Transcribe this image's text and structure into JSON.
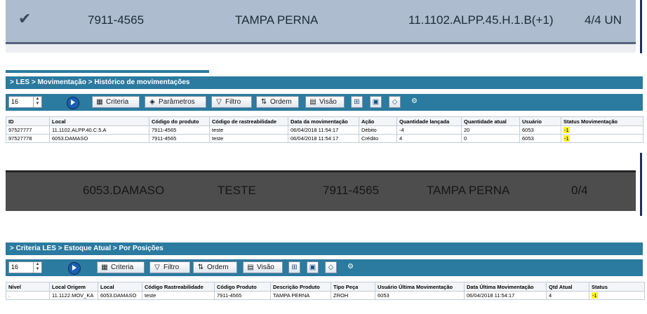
{
  "banner_top": {
    "check_icon": "✓",
    "product_code": "7911-4565",
    "description": "TAMPA PERNA",
    "location": "11.1102.ALPP.45.H.1.B(+1)",
    "quantity": "4/4 UN"
  },
  "window1": {
    "title": "> LES > Movimentação > Histórico de movimentações",
    "spinner_value": "16",
    "toolbar": {
      "criteria": "Criteria",
      "parametros": "Parâmetros",
      "filtro": "Filtro",
      "ordem": "Ordem",
      "visao": "Visão"
    },
    "columns": [
      "ID",
      "Local",
      "Código do produto",
      "Código de rastreabilidade",
      "Data da movimentação",
      "Ação",
      "Quantidade lançada",
      "Quantidade atual",
      "Usuário",
      "Status Movimentação"
    ],
    "rows": [
      [
        "97527777",
        "11.1102.ALPP.40.C.5.A",
        "7911-4565",
        "teste",
        "06/04/2018 11:54:17",
        "Débito",
        "-4",
        "20",
        "6053",
        "-1"
      ],
      [
        "97527778",
        "6053.DAMASO",
        "7911-4565",
        "teste",
        "06/04/2018 11:54:17",
        "Crédito",
        "4",
        "0",
        "6053",
        "-1"
      ]
    ]
  },
  "banner_dark": {
    "location": "6053.DAMASO",
    "tracking": "TESTE",
    "product_code": "7911-4565",
    "description": "TAMPA PERNA",
    "quantity": "0/4"
  },
  "window2": {
    "title": "> Criteria LES > Estoque Atual > Por Posições",
    "spinner_value": "16",
    "toolbar": {
      "criteria": "Criteria",
      "filtro": "Filtro",
      "ordem": "Ordem",
      "visao": "Visão"
    },
    "columns": [
      "Nível",
      "Local Origem",
      "Local",
      "Código Rastreabilidade",
      "Código Produto",
      "Descrição Produto",
      "Tipo Peça",
      "Usuário Última Movimentação",
      "Data Última Movimentação",
      "Qtd Atual",
      "Status"
    ],
    "rows": [
      [
        ".",
        "11.1122.MOV_KA",
        "6053.DAMASO",
        "teste",
        "7911-4565",
        "TAMPA PERNA",
        "ZROH",
        "6053",
        "06/04/2018 11:54:17",
        "4",
        "-1"
      ]
    ]
  },
  "colors": {
    "titlebar": "#2b7a9f",
    "banner_top": "#aebccf",
    "banner_dark": "#4d4d4d",
    "highlight": "#fff227"
  }
}
